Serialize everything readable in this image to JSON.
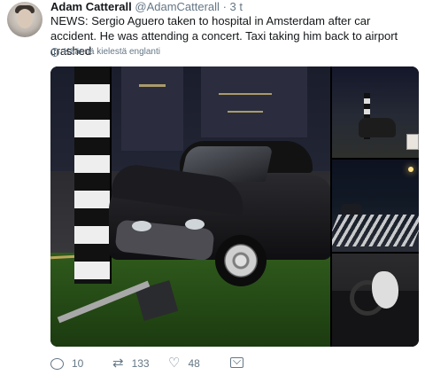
{
  "tweet": {
    "author_name": "Adam Catterall",
    "author_handle": "@AdamCatterall",
    "separator": "·",
    "time": "3 t",
    "text": "NEWS: Sergio Aguero taken to hospital in Amsterdam after car accident. He was attending a concert. Taxi taking him back to airport crashed",
    "translate_label": "Käännä kielestä englanti"
  },
  "media": {
    "photo_count": 4
  },
  "actions": {
    "reply_count": "10",
    "retweet_count": "133",
    "like_count": "48",
    "reply_icon": "reply-icon",
    "retweet_icon": "retweet-icon",
    "like_icon": "heart-icon",
    "message_icon": "direct-message-icon"
  },
  "colors": {
    "text_primary": "#14171a",
    "text_secondary": "#657786"
  }
}
